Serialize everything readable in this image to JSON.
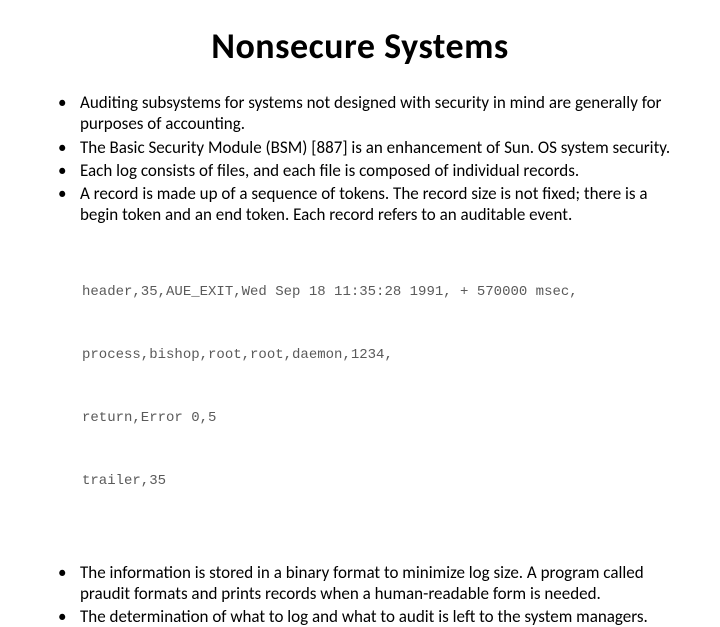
{
  "title": "Nonsecure Systems",
  "bullets_top": [
    "Auditing subsystems for systems not designed with security in mind are generally for purposes of accounting.",
    "The Basic Security Module (BSM) [887] is an enhancement of Sun. OS system security.",
    "Each log consists of files, and each file is composed of individual records.",
    "A record is made up of a sequence of tokens. The record size is not fixed; there is a begin token and an end token. Each record refers to an auditable event."
  ],
  "code": {
    "line1": "header,35,AUE_EXIT,Wed Sep 18 11:35:28 1991, + 570000 msec,",
    "line2": "process,bishop,root,root,daemon,1234,",
    "line3": "return,Error 0,5",
    "line4": "trailer,35"
  },
  "bullets_bottom": [
    "The information is stored in a binary format to minimize log size. A program called praudit formats and prints records when a human-readable form is needed.",
    "The determination of what to log and what to audit is left to the system managers."
  ]
}
